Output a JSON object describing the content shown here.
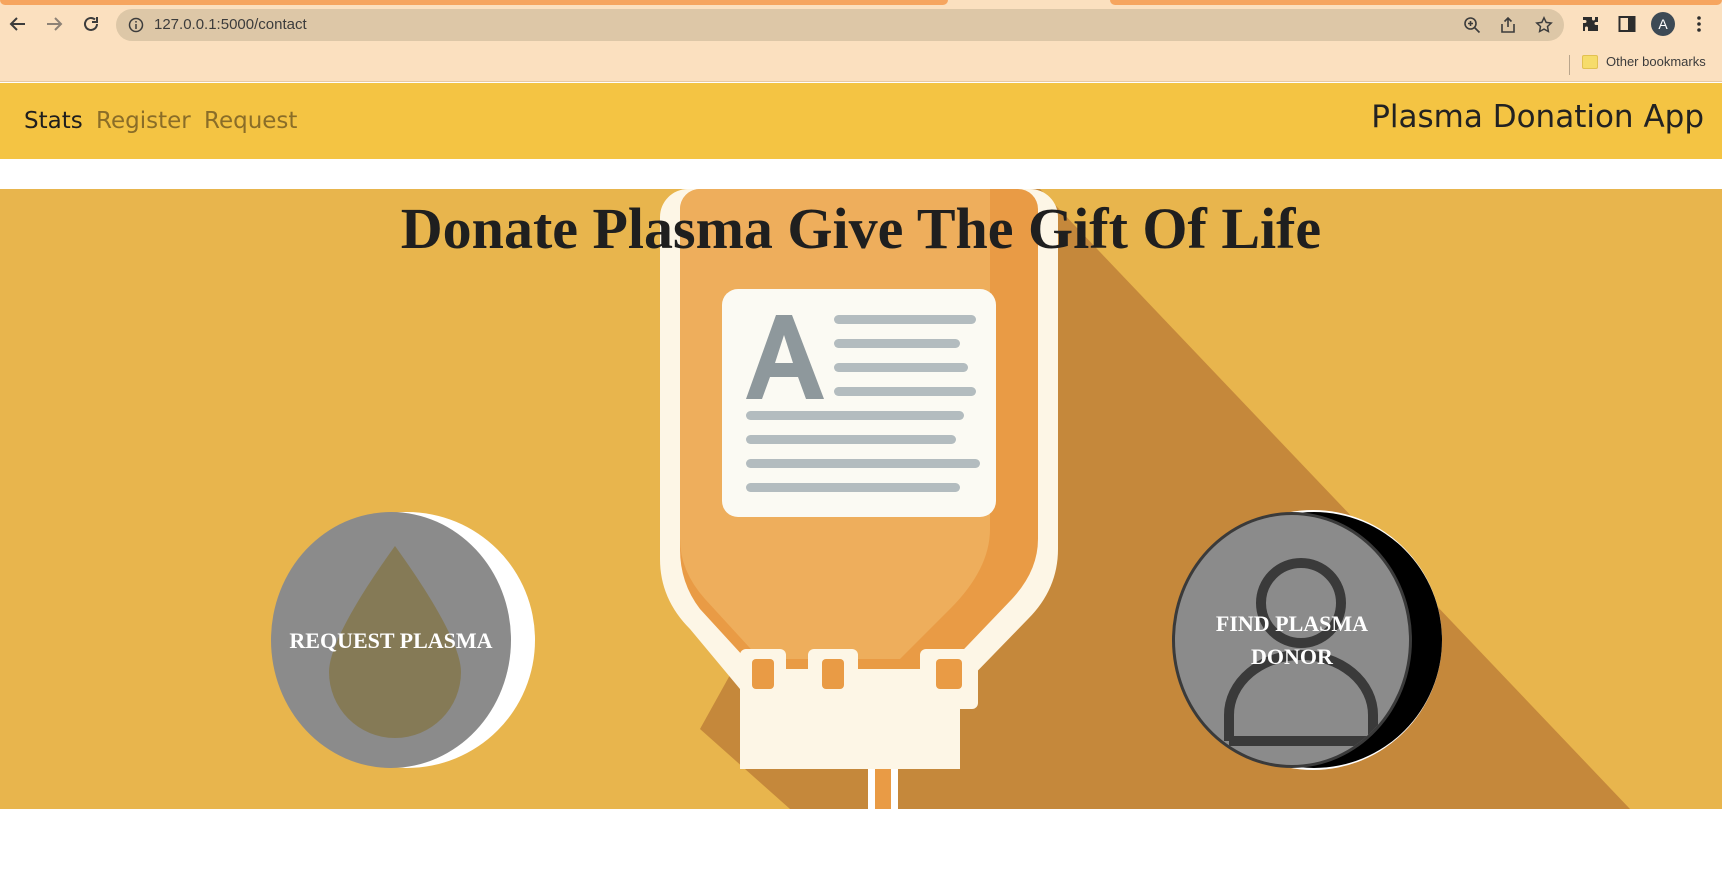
{
  "browser": {
    "url": "127.0.0.1:5000/contact",
    "avatar_letter": "A",
    "bookmarks_folder": "Other bookmarks",
    "icons": [
      "back-icon",
      "forward-icon",
      "reload-icon",
      "site-info-icon",
      "zoom-icon",
      "share-icon",
      "star-icon",
      "extensions-icon",
      "side-panel-icon",
      "menu-icon",
      "folder-icon"
    ]
  },
  "navbar": {
    "links": [
      {
        "label": "Stats",
        "active": true
      },
      {
        "label": "Register",
        "active": false
      },
      {
        "label": "Request",
        "active": false
      }
    ],
    "brand": "Plasma Donation App"
  },
  "hero": {
    "title": "Donate Plasma Give The Gift Of Life",
    "request_button": "REQUEST PLASMA",
    "donor_button": "FIND PLASMA DONOR"
  },
  "colors": {
    "chrome_bg": "#fbe0bf",
    "navbar_bg": "#f4c443",
    "hero_bg": "#e8b54d",
    "bag_orange": "#e99b45",
    "circle_gray": "#8b8b8b"
  }
}
